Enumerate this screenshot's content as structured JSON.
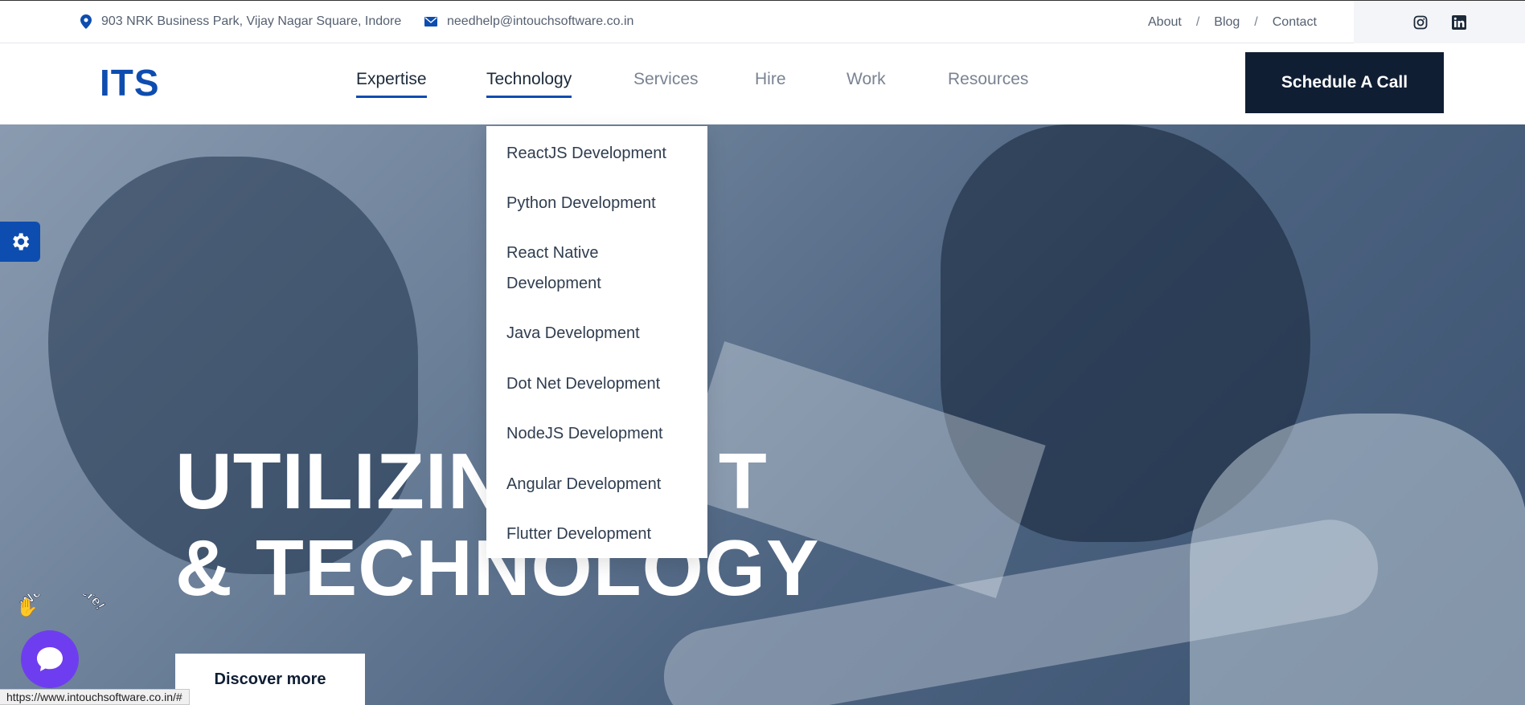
{
  "topbar": {
    "address": "903 NRK Business Park, Vijay Nagar Square, Indore",
    "email": "needhelp@intouchsoftware.co.in",
    "links": [
      "About",
      "Blog",
      "Contact"
    ],
    "sep": "/"
  },
  "nav": {
    "logo": "ITS",
    "menu": [
      "Expertise",
      "Technology",
      "Services",
      "Hire",
      "Work",
      "Resources"
    ],
    "cta": "Schedule A Call"
  },
  "dropdown": {
    "items": [
      "ReactJS Development",
      "Python Development",
      "React Native Development",
      "Java Development",
      "Dot Net Development",
      "NodeJS Development",
      "Angular Development",
      "Flutter Development"
    ]
  },
  "hero": {
    "line1": "UTILIZIN",
    "line1_end": "T",
    "line2": "& TECHNOLOGY",
    "button": "Discover more"
  },
  "chat": {
    "badge": "We Are Here!",
    "wave": "✋"
  },
  "status": {
    "url": "https://www.intouchsoftware.co.in/#"
  },
  "colors": {
    "accent": "#0e4db0",
    "dark": "#0f1e33",
    "chat": "#6f3df0"
  }
}
